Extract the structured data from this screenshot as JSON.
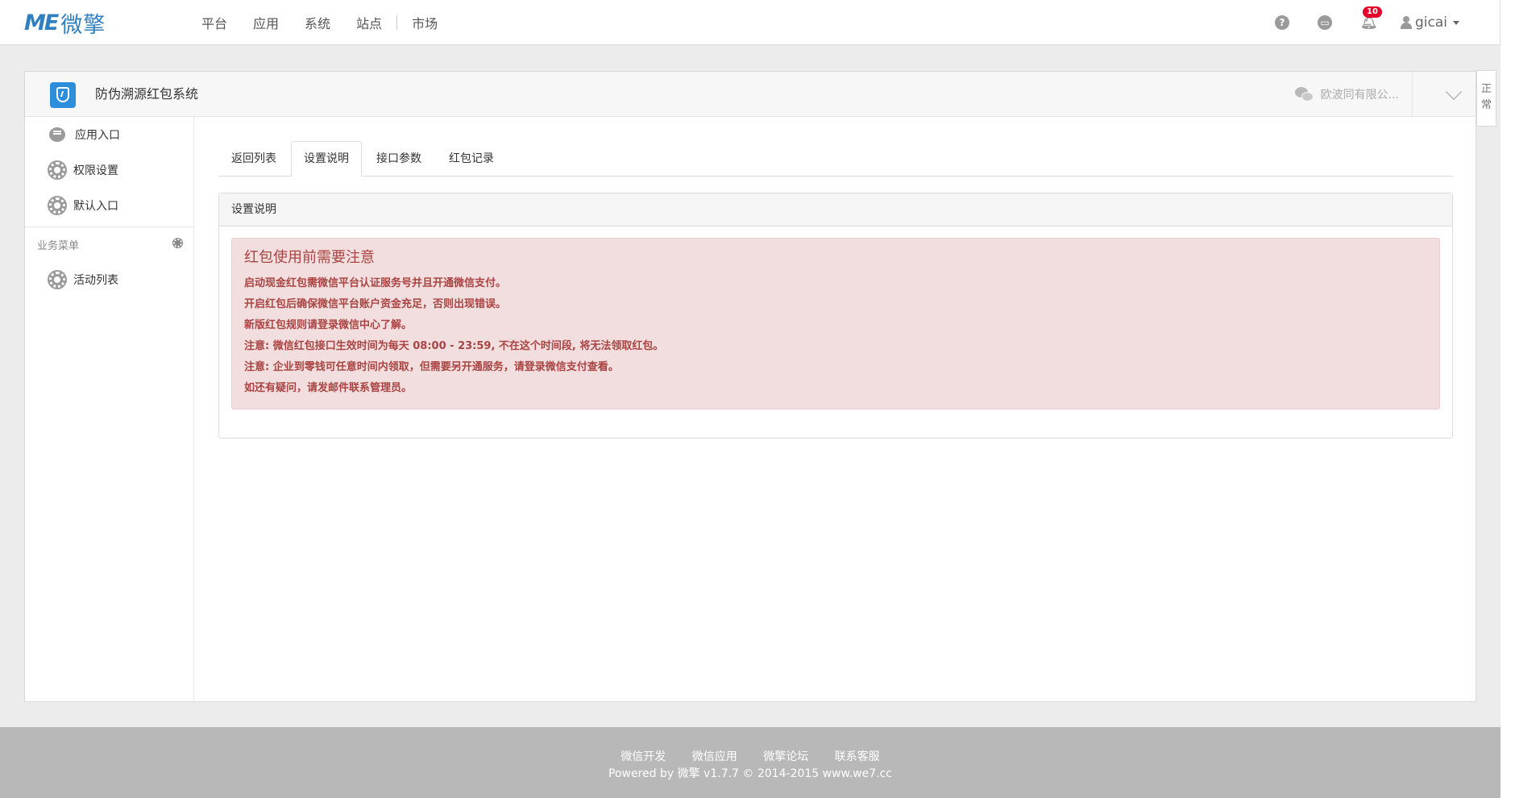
{
  "navbar": {
    "logo_mark": "ME",
    "logo_word": "微擎",
    "menu": [
      "平台",
      "应用",
      "系统",
      "站点",
      "市场"
    ],
    "help_icon": "?",
    "notice_count": "10",
    "username": "gicai"
  },
  "app_header": {
    "title": "防伪溯源红包系统",
    "account": "欧波同有限公...",
    "side_tab": "正常"
  },
  "sidebar": {
    "items": [
      "应用入口",
      "权限设置",
      "默认入口"
    ],
    "group_title": "业务菜单",
    "group_items": [
      "活动列表"
    ]
  },
  "tabs": [
    "返回列表",
    "设置说明",
    "接口参数",
    "红包记录"
  ],
  "active_tab": "设置说明",
  "box_title": "设置说明",
  "alert": {
    "heading": "红包使用前需要注意",
    "lines": [
      "启动现金红包需微信平台认证服务号并且开通微信支付。",
      "开启红包后确保微信平台账户资金充足，否则出现错误。",
      "新版红包规则请登录微信中心了解。",
      "注意: 微信红包接口生效时间为每天 08:00 - 23:59, 不在这个时间段, 将无法领取红包。",
      "注意: 企业到零钱可任意时间内领取，但需要另开通服务，请登录微信支付查看。",
      "如还有疑问，请发邮件联系管理员。"
    ]
  },
  "footer": {
    "links": [
      "微信开发",
      "微信应用",
      "微擎论坛",
      "联系客服"
    ],
    "copyright": "Powered by 微擎 v1.7.7 © 2014-2015 www.we7.cc"
  },
  "colors": {
    "accent": "#2f7fc1",
    "alert_bg": "#f2dede",
    "alert_text": "#a94442",
    "footer_bg": "#b8b8b8"
  }
}
